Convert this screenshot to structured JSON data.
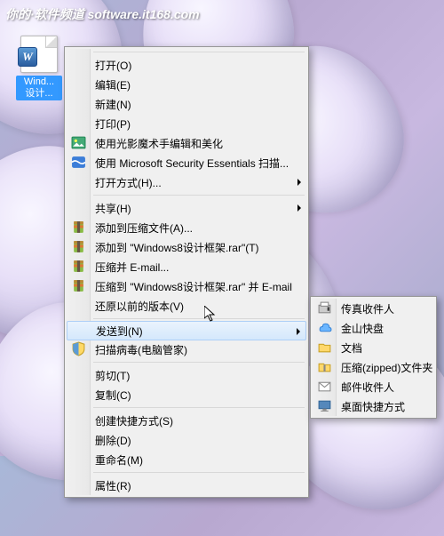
{
  "watermark": "你的·软件频道 software.it168.com",
  "file": {
    "label": "Wind...\n设计..."
  },
  "menu1": [
    {
      "t": "sep"
    },
    {
      "label": "打开(O)"
    },
    {
      "label": "编辑(E)"
    },
    {
      "label": "新建(N)"
    },
    {
      "label": "打印(P)"
    },
    {
      "label": "使用光影魔术手编辑和美化",
      "icon": "photo"
    },
    {
      "label": "使用 Microsoft Security Essentials 扫描...",
      "icon": "mse"
    },
    {
      "label": "打开方式(H)...",
      "arrow": true
    },
    {
      "t": "sep"
    },
    {
      "label": "共享(H)",
      "arrow": true
    },
    {
      "label": "添加到压缩文件(A)...",
      "icon": "rar"
    },
    {
      "label": "添加到 \"Windows8设计框架.rar\"(T)",
      "icon": "rar"
    },
    {
      "label": "压缩并 E-mail...",
      "icon": "rar"
    },
    {
      "label": "压缩到 \"Windows8设计框架.rar\" 并 E-mail",
      "icon": "rar"
    },
    {
      "label": "还原以前的版本(V)"
    },
    {
      "t": "sep"
    },
    {
      "label": "发送到(N)",
      "arrow": true,
      "hl": true
    },
    {
      "label": "扫描病毒(电脑管家)",
      "icon": "shield"
    },
    {
      "t": "sep"
    },
    {
      "label": "剪切(T)"
    },
    {
      "label": "复制(C)"
    },
    {
      "t": "sep"
    },
    {
      "label": "创建快捷方式(S)"
    },
    {
      "label": "删除(D)"
    },
    {
      "label": "重命名(M)"
    },
    {
      "t": "sep"
    },
    {
      "label": "属性(R)"
    }
  ],
  "menu2": [
    {
      "label": "传真收件人",
      "icon": "fax"
    },
    {
      "label": "金山快盘",
      "icon": "ks"
    },
    {
      "label": "文档",
      "icon": "docs"
    },
    {
      "label": "压缩(zipped)文件夹",
      "icon": "zip"
    },
    {
      "label": "邮件收件人",
      "icon": "mail"
    },
    {
      "label": "桌面快捷方式",
      "icon": "desktop"
    }
  ]
}
